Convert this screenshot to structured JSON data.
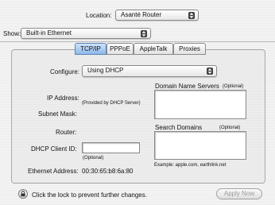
{
  "location": {
    "label": "Location:",
    "value": "Asanté Router"
  },
  "show": {
    "label": "Show:",
    "value": "Built-in Ethernet"
  },
  "tabs": [
    {
      "label": "TCP/IP",
      "active": true
    },
    {
      "label": "PPPoE",
      "active": false
    },
    {
      "label": "AppleTalk",
      "active": false
    },
    {
      "label": "Proxies",
      "active": false
    }
  ],
  "configure": {
    "label": "Configure:",
    "value": "Using DHCP"
  },
  "ip_address": {
    "label": "IP Address:",
    "note": "(Provided by DHCP Server)"
  },
  "subnet_mask": {
    "label": "Subnet Mask:"
  },
  "router": {
    "label": "Router:"
  },
  "dhcp_client_id": {
    "label": "DHCP Client ID:",
    "value": "",
    "note": "(Optional)"
  },
  "ethernet_address": {
    "label": "Ethernet Address:",
    "value": "00:30:65:b8:6a:80"
  },
  "dns": {
    "label": "Domain Name Servers",
    "optional": "(Optional)",
    "value": ""
  },
  "search_domains": {
    "label": "Search Domains",
    "optional": "(Optional)",
    "value": "",
    "example": "Example: apple.com, earthlink.net"
  },
  "footer": {
    "lock_text": "Click the lock to prevent further changes.",
    "apply_label": "Apply Now"
  }
}
